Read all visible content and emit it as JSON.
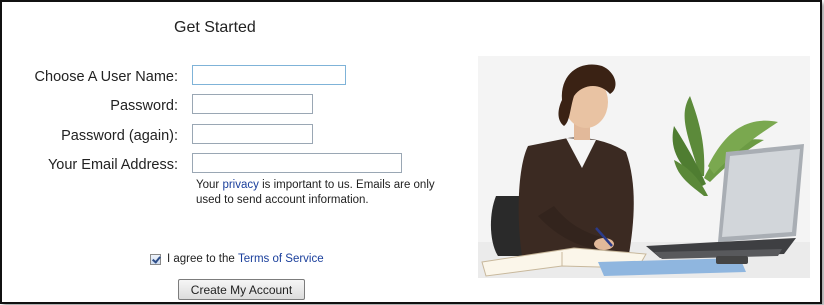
{
  "form": {
    "title": "Get Started",
    "username_label": "Choose A User Name:",
    "password_label": "Password:",
    "password_again_label": "Password (again):",
    "email_label": "Your Email Address:",
    "username_value": "",
    "password_value": "",
    "password_again_value": "",
    "email_value": "",
    "privacy_note_before": "Your ",
    "privacy_link": "privacy",
    "privacy_note_after": " is important to us. Emails are only used to send account information.",
    "agree_checked": true,
    "agree_text": "I agree to the ",
    "terms_link": "Terms of Service",
    "submit_label": "Create My Account"
  },
  "colors": {
    "link": "#1a3f9c",
    "input_border": "#9aa7b4",
    "focus_border": "#7fb3d8"
  },
  "image": {
    "icon": "woman-at-laptop-photo"
  }
}
